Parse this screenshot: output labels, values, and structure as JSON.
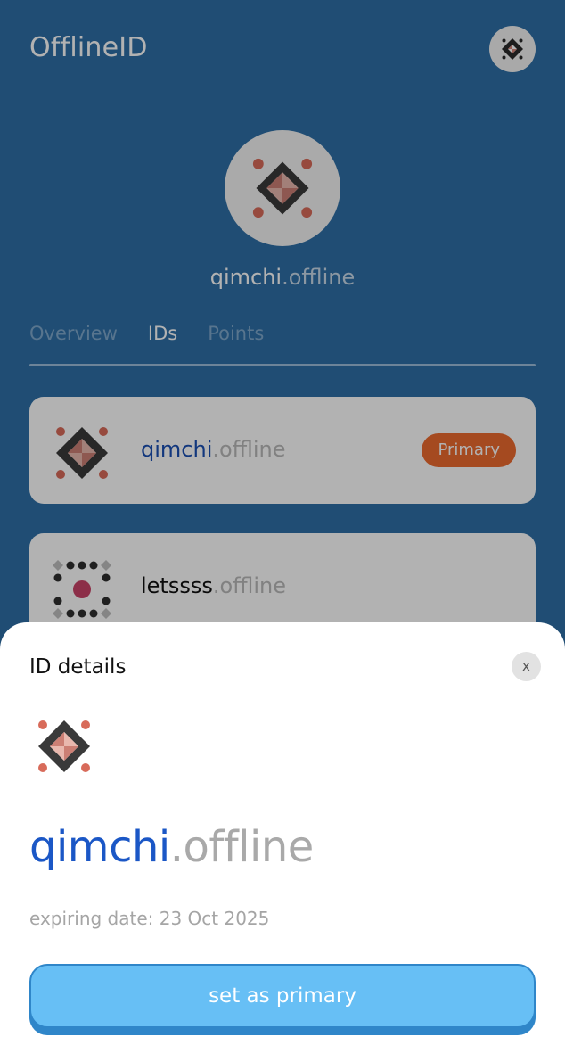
{
  "header": {
    "app_title": "OfflineID"
  },
  "profile": {
    "name_main": "qimchi",
    "name_suffix": ".offline"
  },
  "tabs": [
    {
      "label": "Overview",
      "active": false
    },
    {
      "label": "IDs",
      "active": true
    },
    {
      "label": "Points",
      "active": false
    }
  ],
  "id_list": [
    {
      "name_main": "qimchi",
      "name_suffix": ".offline",
      "badge": "Primary",
      "icon": "quilt-pattern-icon"
    },
    {
      "name_main": "letssss",
      "name_suffix": ".offline",
      "icon": "dot-grid-pattern-icon"
    }
  ],
  "sheet": {
    "title": "ID details",
    "close_label": "x",
    "name_main": "qimchi",
    "name_suffix": ".offline",
    "expiring_label": "expiring date: 23 Oct 2025",
    "set_primary_label": "set as primary"
  },
  "colors": {
    "background_blue": "#2e6fa6",
    "accent_blue": "#1b57c6",
    "badge_orange": "#ec6a2f",
    "button_blue": "#67bff5"
  }
}
